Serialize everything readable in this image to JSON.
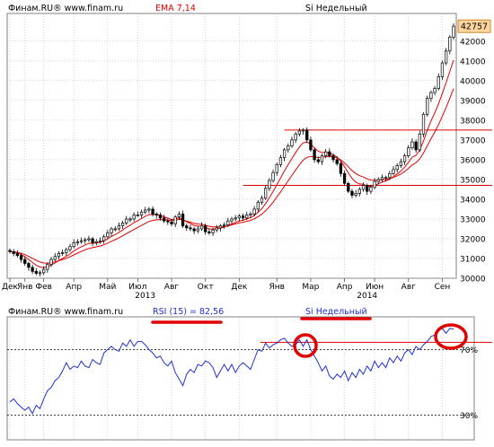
{
  "header": {
    "source": "Финам.RU®  www.finam.ru",
    "indicator": "EMA 7,14",
    "instrument": "Si Недельный"
  },
  "header2": {
    "source": "Финам.RU®  www.finam.ru",
    "indicator": "RSI (15) = 82,56",
    "instrument": "Si Недельный"
  },
  "colors": {
    "up": "#ffffff",
    "down": "#000000",
    "ema": "#e00000",
    "rsi": "#1f2fd6",
    "annotation": "#e00000",
    "grid": "#b8b8b8",
    "background": "#ffffff",
    "price_label_bg": "#ffd6a0"
  },
  "chart_data": [
    {
      "type": "candlestick",
      "title": "Si Недельный",
      "last_price": 42757,
      "last_price_label": "42757",
      "y_ticks": [
        30000,
        31000,
        32000,
        33000,
        34000,
        35000,
        36000,
        37000,
        38000,
        39000,
        40000,
        41000,
        42000
      ],
      "y_tick_labels": [
        "30000",
        "31000",
        "32000",
        "33000",
        "34000",
        "35000",
        "36000",
        "37000",
        "38000",
        "39000",
        "40000",
        "41000",
        "42000"
      ],
      "ylim": [
        30000,
        43400
      ],
      "month_labels": [
        "Дек",
        "Янв",
        "Фев",
        "Апр",
        "Май",
        "Июл",
        "Авг",
        "Окт",
        "Дек",
        "Янв",
        "Мар",
        "Апр",
        "Июн",
        "Авг",
        "Сен"
      ],
      "month_label_weeks": [
        0,
        4,
        9,
        17,
        26,
        34,
        43,
        52,
        61,
        71,
        80,
        89,
        97,
        106,
        115
      ],
      "year_labels": [
        "2013",
        "2014"
      ],
      "year_label_weeks": [
        36,
        95
      ],
      "horizontal_levels": [
        {
          "value": 37500,
          "from_week": 73
        },
        {
          "value": 34700,
          "from_week": 62
        }
      ],
      "weekly_close": [
        31350,
        31250,
        31150,
        30950,
        30750,
        30550,
        30350,
        30250,
        30280,
        30450,
        30700,
        30950,
        31100,
        31250,
        31300,
        31450,
        31600,
        31800,
        31850,
        31900,
        31950,
        32000,
        31800,
        31850,
        31900,
        32100,
        32300,
        32500,
        32500,
        32650,
        32800,
        33000,
        33000,
        33200,
        33200,
        33350,
        33450,
        33500,
        33250,
        33200,
        33050,
        32900,
        32850,
        32750,
        33100,
        33250,
        32650,
        32550,
        32500,
        32400,
        32500,
        32650,
        32350,
        32300,
        32450,
        32550,
        32650,
        32700,
        32900,
        33000,
        33050,
        33150,
        33050,
        33200,
        33250,
        33500,
        33850,
        34050,
        34550,
        34950,
        35350,
        35750,
        36100,
        36500,
        36700,
        37000,
        37300,
        37450,
        37500,
        37000,
        36500,
        36000,
        35900,
        36200,
        36400,
        36200,
        36000,
        35800,
        35300,
        34800,
        34400,
        34200,
        34300,
        34500,
        34700,
        34400,
        34600,
        34900,
        35000,
        35100,
        35100,
        35300,
        35500,
        35700,
        35900,
        36200,
        36600,
        36900,
        36500,
        37300,
        38300,
        39100,
        39400,
        39600,
        40200,
        40900,
        41500,
        42200,
        42757
      ],
      "ema_fast_label": "EMA 7",
      "ema_slow_label": "EMA 14"
    },
    {
      "type": "line",
      "title": "RSI (15) = 82,56",
      "series_name": "RSI (15)",
      "last_value": 82.56,
      "y_ticks": [
        30,
        70
      ],
      "y_tick_labels": [
        "30%",
        "70%"
      ],
      "ylim": [
        15,
        90
      ],
      "level": 74.5,
      "values": [
        38,
        40,
        37,
        35,
        33,
        35,
        31,
        36,
        34,
        40,
        45,
        47,
        51,
        53,
        57,
        62,
        58,
        60,
        59,
        63,
        60,
        59,
        64,
        62,
        61,
        68,
        70,
        72,
        70,
        69,
        74,
        72,
        76,
        72,
        75,
        75,
        73,
        70,
        68,
        65,
        66,
        62,
        60,
        63,
        56,
        52,
        48,
        55,
        58,
        56,
        61,
        60,
        63,
        62,
        59,
        53,
        57,
        61,
        57,
        61,
        56,
        60,
        62,
        60,
        58,
        64,
        70,
        69,
        74,
        71,
        73,
        74,
        76,
        77,
        74,
        72,
        73,
        76,
        72,
        76,
        70,
        66,
        62,
        57,
        60,
        54,
        52,
        55,
        53,
        57,
        51,
        56,
        53,
        58,
        55,
        60,
        57,
        63,
        59,
        62,
        59,
        65,
        62,
        66,
        63,
        68,
        70,
        67,
        72,
        70,
        73,
        75,
        78,
        79,
        82,
        83,
        80,
        83,
        82.56
      ]
    }
  ]
}
